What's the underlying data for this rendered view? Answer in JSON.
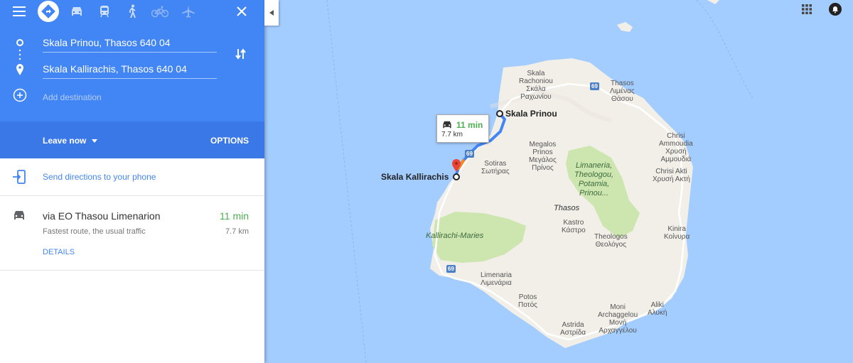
{
  "travel_modes": [
    "menu-icon",
    "directions-icon",
    "car-icon",
    "transit-icon",
    "walk-icon",
    "bicycle-icon",
    "flight-icon",
    "close-icon"
  ],
  "origin": "Skala Prinou, Thasos 640 04",
  "destination": "Skala Kallirachis, Thasos 640 04",
  "add_destination": "Add destination",
  "leave_now": "Leave now",
  "options": "OPTIONS",
  "send_directions": "Send directions to your phone",
  "route": {
    "name": "via EO Thasou Limenarion",
    "time": "11 min",
    "description": "Fastest route, the usual traffic",
    "distance": "7.7 km",
    "details": "DETAILS"
  },
  "map": {
    "bubble_time": "11 min",
    "bubble_distance": "7.7 km",
    "start_marker": "Skala Prinou",
    "end_marker": "Skala Kallirachis",
    "road_shield": "69",
    "labels": {
      "skala_rachoniou": "Skala\nRachoniou\nΣκάλα\nΡαχωνίου",
      "thasos_limenas": "Thasos\nΛιμένας\nΘάσου",
      "megalos_prinos": "Megalos\nPrinos\nΜεγάλος\nΠρίνος",
      "sotiras": "Sotiras\nΣωτήρας",
      "chrisi_ammoudia": "Chrisi\nAmmoudia\nΧρυσή\nΑμμουδιά",
      "chrisi_akti": "Chrisi Akti\nΧρυσή Ακτή",
      "limaneria_park": "Limaneria,\nTheologou,\nPotamia,\nPrinou...",
      "thasos_island": "Thasos",
      "kastro": "Kastro\nΚάστρο",
      "kallirachi_maries": "Kallirachi-Maries",
      "kinira": "Kinira\nΚοίνυρα",
      "theologos": "Theologos\nΘεολόγος",
      "limenaria": "Limenaria\nΛιμενάρια",
      "potos": "Potos\nΠοτός",
      "moni_archangelou": "Moni\nArchaggelou\nΜονή\nΑρχαγγέλου",
      "aliki": "Aliki\nΑλυκή",
      "astrida": "Astrida\nΑστρίδα"
    }
  },
  "colors": {
    "header_blue": "#4285f4",
    "subbar_blue": "#3b78e7",
    "green_time": "#4caf50",
    "map_water": "#a3ccff",
    "land": "#f2efe9",
    "park": "#cde6b0",
    "route_line": "#4285f4"
  }
}
